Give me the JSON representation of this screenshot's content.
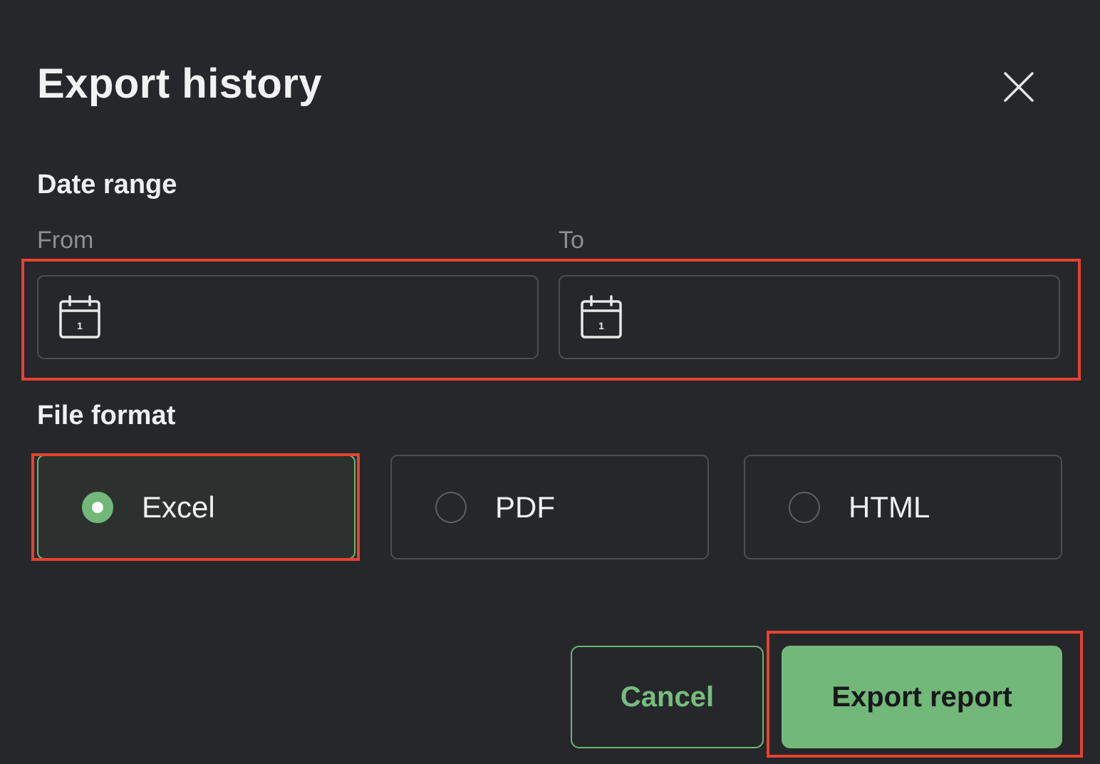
{
  "dialog": {
    "title": "Export history",
    "close_icon": "close-icon"
  },
  "date_range": {
    "section_label": "Date range",
    "from": {
      "label": "From",
      "value": "",
      "icon": "calendar-icon",
      "calendar_day": "1"
    },
    "to": {
      "label": "To",
      "value": "",
      "icon": "calendar-icon",
      "calendar_day": "1"
    }
  },
  "file_format": {
    "section_label": "File format",
    "selected": "Excel",
    "options": [
      {
        "label": "Excel",
        "checked": true
      },
      {
        "label": "PDF",
        "checked": false
      },
      {
        "label": "HTML",
        "checked": false
      }
    ]
  },
  "actions": {
    "cancel_label": "Cancel",
    "export_label": "Export report"
  },
  "colors": {
    "background": "#25272b",
    "accent": "#72b878",
    "highlight": "#e8412f"
  }
}
